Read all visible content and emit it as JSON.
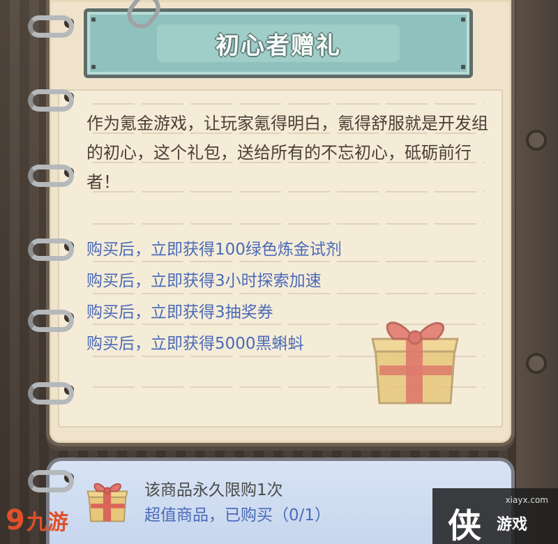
{
  "panel": {
    "title": "初心者赠礼",
    "description": "作为氪金游戏，让玩家氪得明白，氪得舒服就是开发组的初心，这个礼包，送给所有的不忘初心，砥砺前行者！",
    "rewards": [
      "购买后，立即获得100绿色炼金试剂",
      "购买后，立即获得3小时探索加速",
      "购买后，立即获得3抽奖券",
      "购买后，立即获得5000黑蝌蚪"
    ]
  },
  "footer": {
    "limit_text": "该商品永久限购1次",
    "status_text": "超值商品，已购买（0/1）"
  },
  "watermarks": {
    "left_mark": "9",
    "left_text": "九游",
    "right_glyph": "侠",
    "right_text": "游戏",
    "right_url": "xiayx.com"
  },
  "colors": {
    "title_banner": "#8fc2be",
    "paper": "#f5ecd8",
    "reward_text": "#4a6bb8",
    "footer_bg": "#d8e3f4"
  },
  "icons": [
    "gift-box-icon",
    "paperclip-icon",
    "binder-ring-icon"
  ]
}
